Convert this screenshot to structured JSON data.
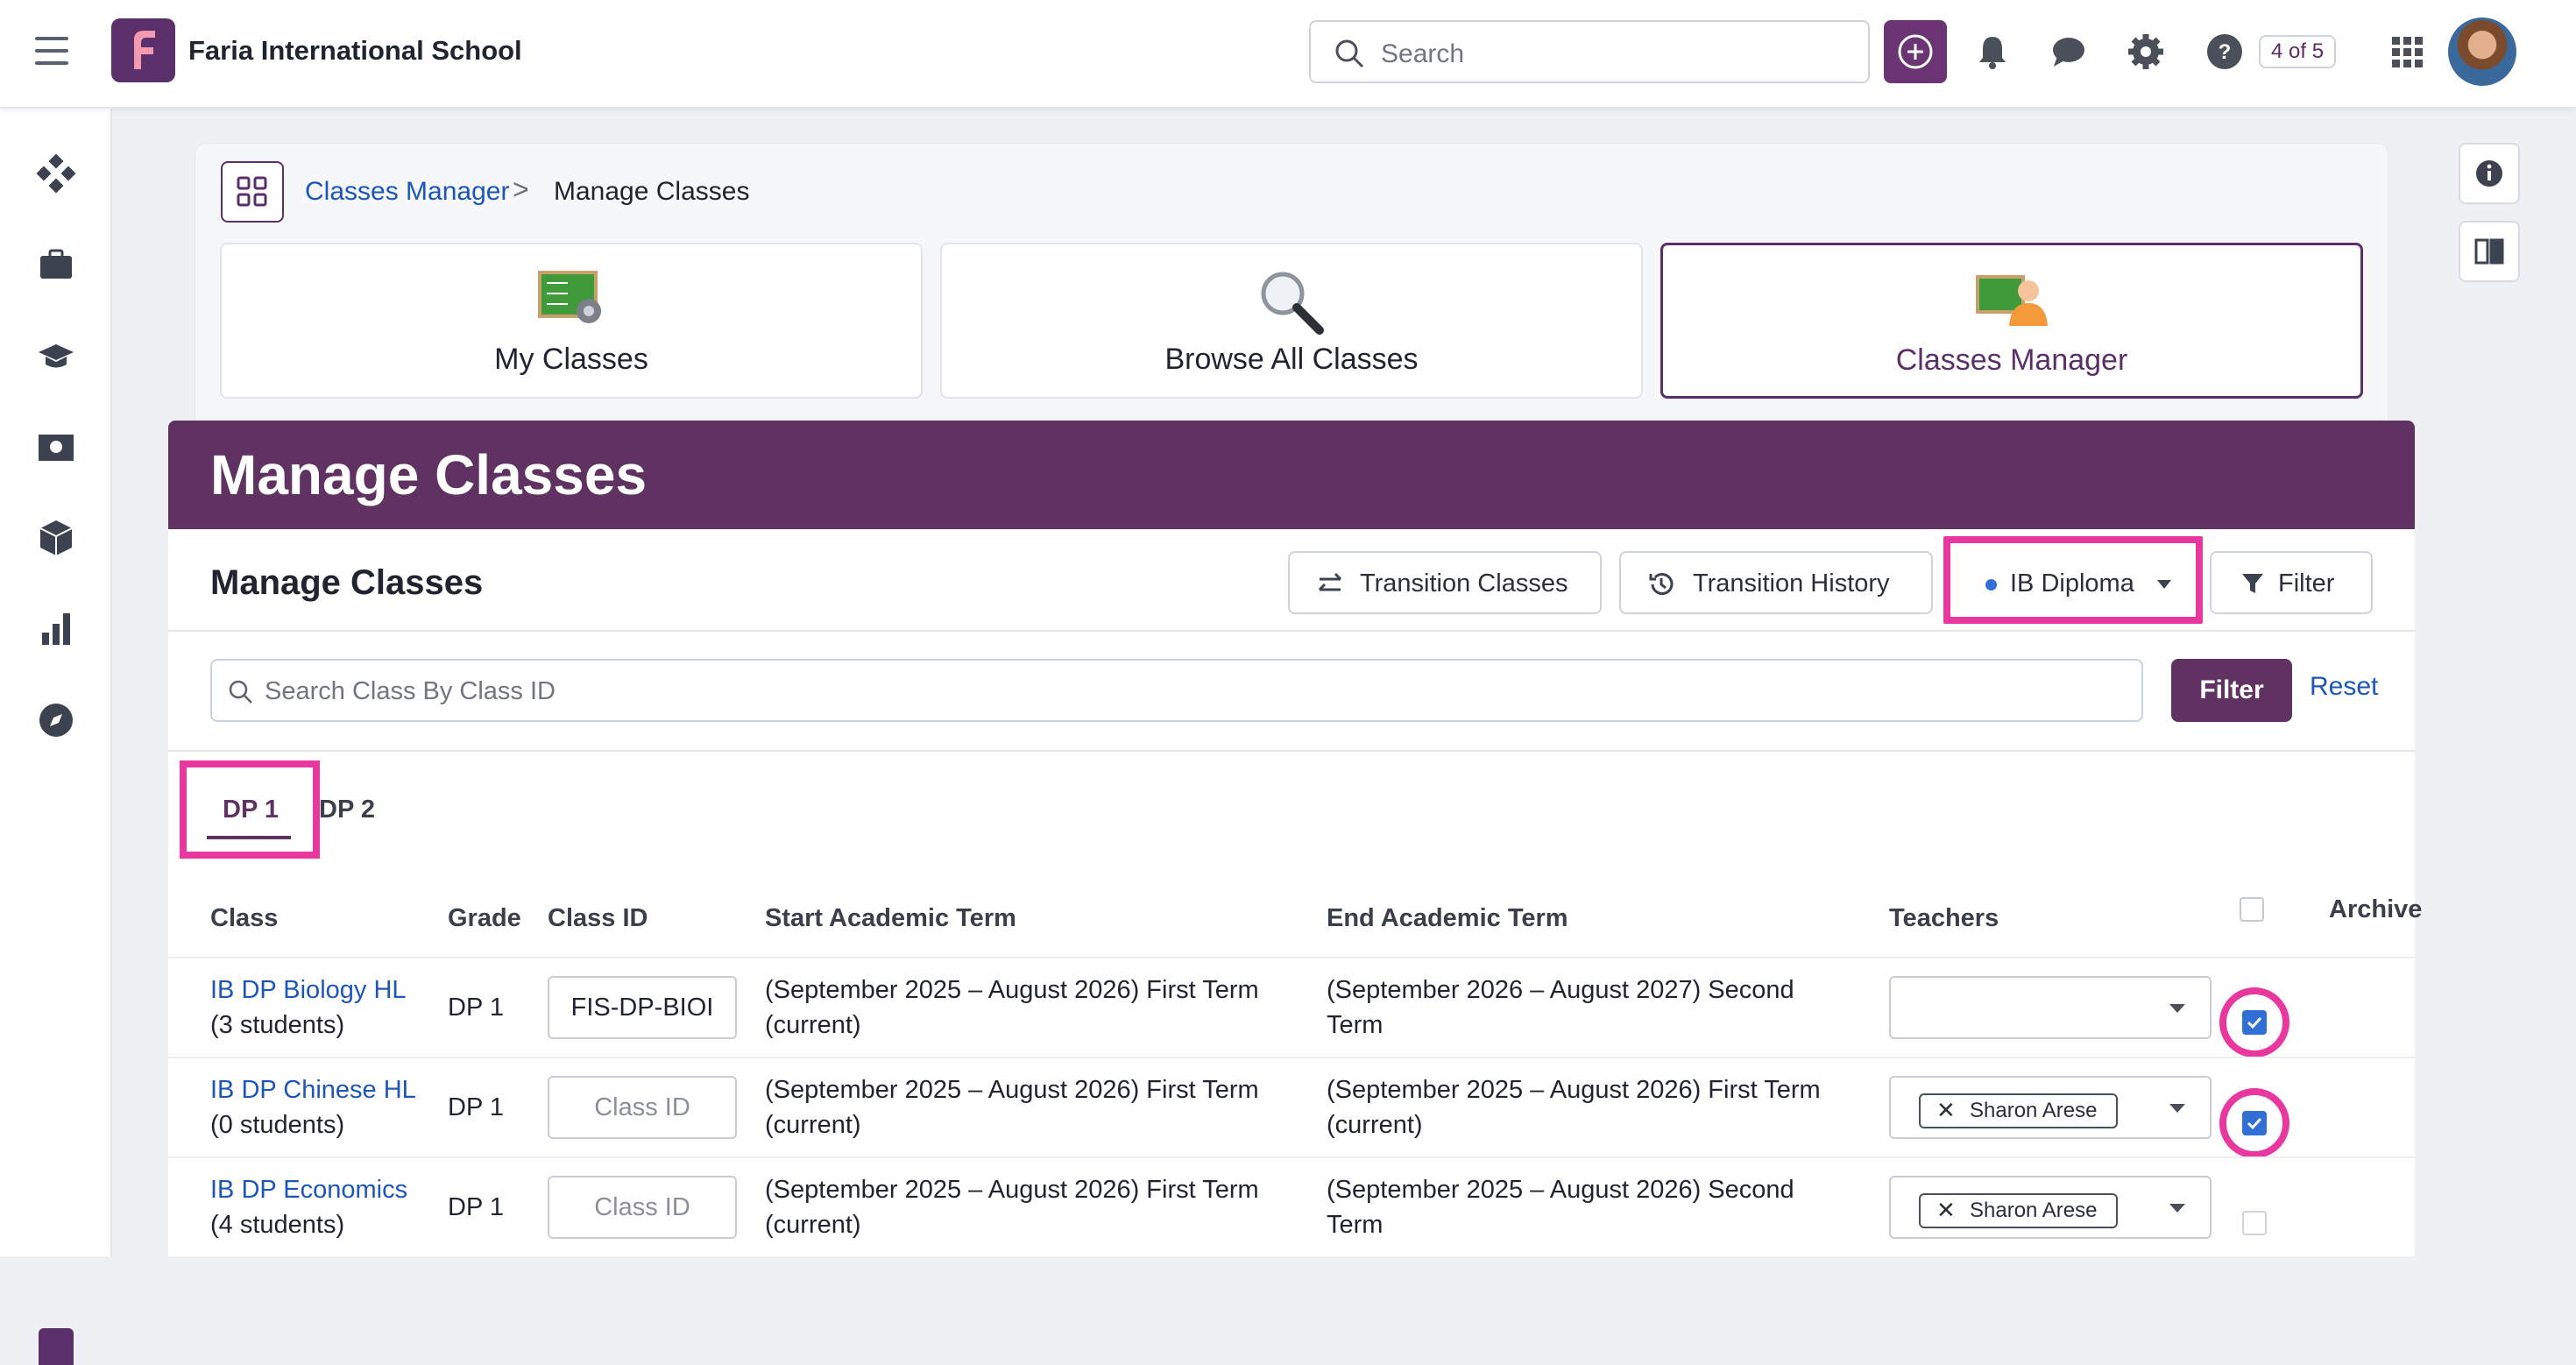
{
  "topbar": {
    "school_name": "Faria International School",
    "search_placeholder": "Search",
    "page_count": "4 of 5",
    "icons": [
      "menu-icon",
      "add-icon",
      "bell-icon",
      "chat-icon",
      "gear-icon",
      "help-icon",
      "apps-grid-icon"
    ]
  },
  "breadcrumb": {
    "parent": "Classes Manager",
    "separator": ">",
    "current": "Manage Classes"
  },
  "tiles": [
    {
      "label": "My Classes",
      "icon": "classroom-board-icon"
    },
    {
      "label": "Browse All Classes",
      "icon": "magnifier-icon"
    },
    {
      "label": "Classes Manager",
      "icon": "teacher-board-icon",
      "selected": true
    }
  ],
  "banner": {
    "title": "Manage Classes"
  },
  "panel": {
    "title": "Manage Classes",
    "transition_classes": "Transition Classes",
    "transition_history": "Transition History",
    "program_select": "IB Diploma",
    "filter": "Filter"
  },
  "search": {
    "placeholder": "Search Class By Class ID",
    "filter_button": "Filter",
    "reset": "Reset"
  },
  "tabs": [
    {
      "label": "DP 1",
      "active": true
    },
    {
      "label": "DP 2",
      "active": false
    }
  ],
  "table": {
    "headers": {
      "class": "Class",
      "grade": "Grade",
      "class_id": "Class ID",
      "start": "Start Academic Term",
      "end": "End Academic Term",
      "teachers": "Teachers",
      "archive": "Archive"
    },
    "rows": [
      {
        "class": "IB DP Biology HL",
        "students": "(3 students)",
        "grade": "DP 1",
        "class_id": "FIS-DP-BIOI",
        "class_id_placeholder": "",
        "start_1": "(September 2025 – August 2026) First Term",
        "start_2": "(current)",
        "end_1": "(September 2026 – August 2027) Second",
        "end_2": "Term",
        "teacher": "",
        "archived": true
      },
      {
        "class": "IB DP Chinese HL",
        "students": "(0 students)",
        "grade": "DP 1",
        "class_id": "",
        "class_id_placeholder": "Class ID",
        "start_1": "(September 2025 – August 2026) First Term",
        "start_2": "(current)",
        "end_1": "(September 2025 – August 2026) First Term",
        "end_2": "(current)",
        "teacher": "Sharon Arese",
        "archived": true
      },
      {
        "class": "IB DP Economics",
        "students": "(4 students)",
        "grade": "DP 1",
        "class_id": "",
        "class_id_placeholder": "Class ID",
        "start_1": "(September 2025 – August 2026) First Term",
        "start_2": "(current)",
        "end_1": "(September 2025 – August 2026) Second",
        "end_2": "Term",
        "teacher": "Sharon Arese",
        "archived": false
      }
    ]
  },
  "colors": {
    "brand_purple": "#5f3262",
    "highlight_pink": "#e8389f",
    "link_blue": "#1c56b8",
    "check_blue": "#2f6fd6"
  }
}
